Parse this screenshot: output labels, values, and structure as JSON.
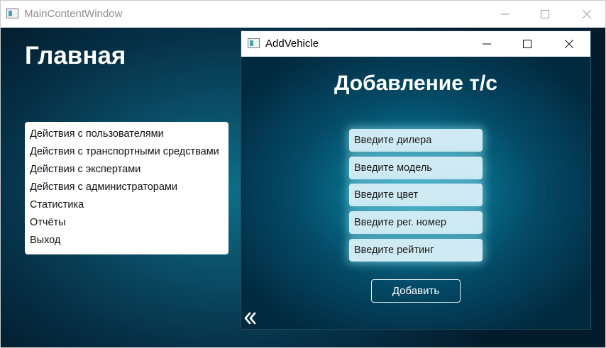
{
  "main_window": {
    "title": "MainContentWindow",
    "heading": "Главная",
    "menu": [
      {
        "label": "Действия с пользователями"
      },
      {
        "label": "Действия с транспортными средствами"
      },
      {
        "label": "Действия с экспертами"
      },
      {
        "label": "Действия с администраторами"
      },
      {
        "label": "Статистика"
      },
      {
        "label": "Отчёты"
      },
      {
        "label": "Выход"
      }
    ]
  },
  "dialog": {
    "title": "AddVehicle",
    "heading": "Добавление т/с",
    "fields": [
      {
        "placeholder": "Введите дилера",
        "value": ""
      },
      {
        "placeholder": "Введите модель",
        "value": ""
      },
      {
        "placeholder": "Введите цвет",
        "value": ""
      },
      {
        "placeholder": "Введите рег. номер",
        "value": ""
      },
      {
        "placeholder": "Введите рейтинг",
        "value": ""
      }
    ],
    "add_button": "Добавить",
    "back_icon": "chevron-double-left-icon"
  },
  "colors": {
    "background_dark": "#031b2b",
    "background_glow": "#0c8aa6",
    "field_fill": "#cfeaf2",
    "text_light": "#ffffff"
  }
}
